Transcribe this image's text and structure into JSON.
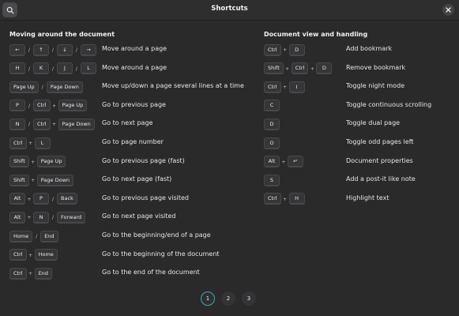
{
  "header": {
    "title": "Shortcuts"
  },
  "left": {
    "title": "Moving around the document",
    "rows": [
      {
        "keys": [
          "←",
          "/",
          "↑",
          "/",
          "↓",
          "/",
          "→"
        ],
        "desc": "Move around a page"
      },
      {
        "keys": [
          "H",
          "/",
          "K",
          "/",
          "J",
          "/",
          "L"
        ],
        "desc": "Move around a page"
      },
      {
        "keys": [
          "Page Up",
          "/",
          "Page Down"
        ],
        "desc": "Move up/down a page several lines at a time"
      },
      {
        "keys": [
          "P",
          "/",
          "Ctrl",
          "+",
          "Page Up"
        ],
        "desc": "Go to previous page"
      },
      {
        "keys": [
          "N",
          "/",
          "Ctrl",
          "+",
          "Page Down"
        ],
        "desc": "Go to next page"
      },
      {
        "keys": [
          "Ctrl",
          "+",
          "L"
        ],
        "desc": "Go to page number"
      },
      {
        "keys": [
          "Shift",
          "+",
          "Page Up"
        ],
        "desc": "Go to previous page (fast)"
      },
      {
        "keys": [
          "Shift",
          "+",
          "Page Down"
        ],
        "desc": "Go to next page (fast)"
      },
      {
        "keys": [
          "Alt",
          "+",
          "P",
          "/",
          "Back"
        ],
        "desc": "Go to previous page visited"
      },
      {
        "keys": [
          "Alt",
          "+",
          "N",
          "/",
          "Forward"
        ],
        "desc": "Go to next page visited"
      },
      {
        "keys": [
          "Home",
          "/",
          "End"
        ],
        "desc": "Go to the beginning/end of a page"
      },
      {
        "keys": [
          "Ctrl",
          "+",
          "Home"
        ],
        "desc": "Go to the beginning of the document"
      },
      {
        "keys": [
          "Ctrl",
          "+",
          "End"
        ],
        "desc": "Go to the end of the document"
      }
    ]
  },
  "right": {
    "title": "Document view and handling",
    "rows": [
      {
        "keys": [
          "Ctrl",
          "+",
          "D"
        ],
        "desc": "Add bookmark"
      },
      {
        "keys": [
          "Shift",
          "+",
          "Ctrl",
          "+",
          "D"
        ],
        "desc": "Remove bookmark"
      },
      {
        "keys": [
          "Ctrl",
          "+",
          "I"
        ],
        "desc": "Toggle night mode"
      },
      {
        "keys": [
          "C"
        ],
        "desc": "Toggle continuous scrolling"
      },
      {
        "keys": [
          "D"
        ],
        "desc": "Toggle dual page"
      },
      {
        "keys": [
          "O"
        ],
        "desc": "Toggle odd pages left"
      },
      {
        "keys": [
          "Alt",
          "+",
          "↵"
        ],
        "desc": "Document properties"
      },
      {
        "keys": [
          "S"
        ],
        "desc": "Add a post-it like note"
      },
      {
        "keys": [
          "Ctrl",
          "+",
          "H"
        ],
        "desc": "Highlight text"
      }
    ]
  },
  "pager": {
    "pages": [
      "1",
      "2",
      "3"
    ],
    "active_index": 0
  },
  "icons": {
    "search": "search-icon",
    "close": "close-icon"
  },
  "colors": {
    "background": "#2a2a2b",
    "accent": "#3fa9b5",
    "key_bg": "#363638"
  }
}
